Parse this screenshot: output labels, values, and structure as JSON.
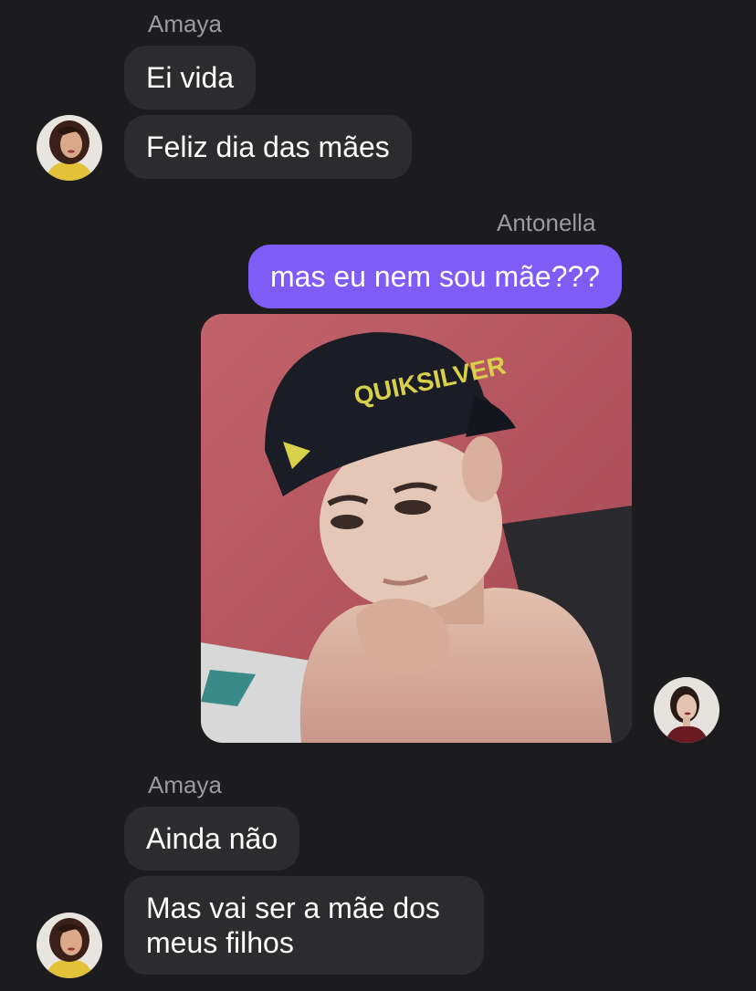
{
  "conversation": {
    "group1": {
      "sender": "Amaya",
      "messages": [
        "Ei vida",
        "Feliz dia das mães"
      ]
    },
    "group2": {
      "sender": "Antonella",
      "messages": [
        "mas eu nem sou mãe???"
      ],
      "photo_text": "QUIKSILVER"
    },
    "group3": {
      "sender": "Amaya",
      "messages": [
        "Ainda não",
        "Mas vai ser a mãe dos meus filhos"
      ]
    }
  },
  "colors": {
    "background": "#1c1c1e",
    "incoming_bubble": "#2c2c2e",
    "outgoing_bubble": "#7e5cf6",
    "name_label": "#9a9aa0"
  }
}
